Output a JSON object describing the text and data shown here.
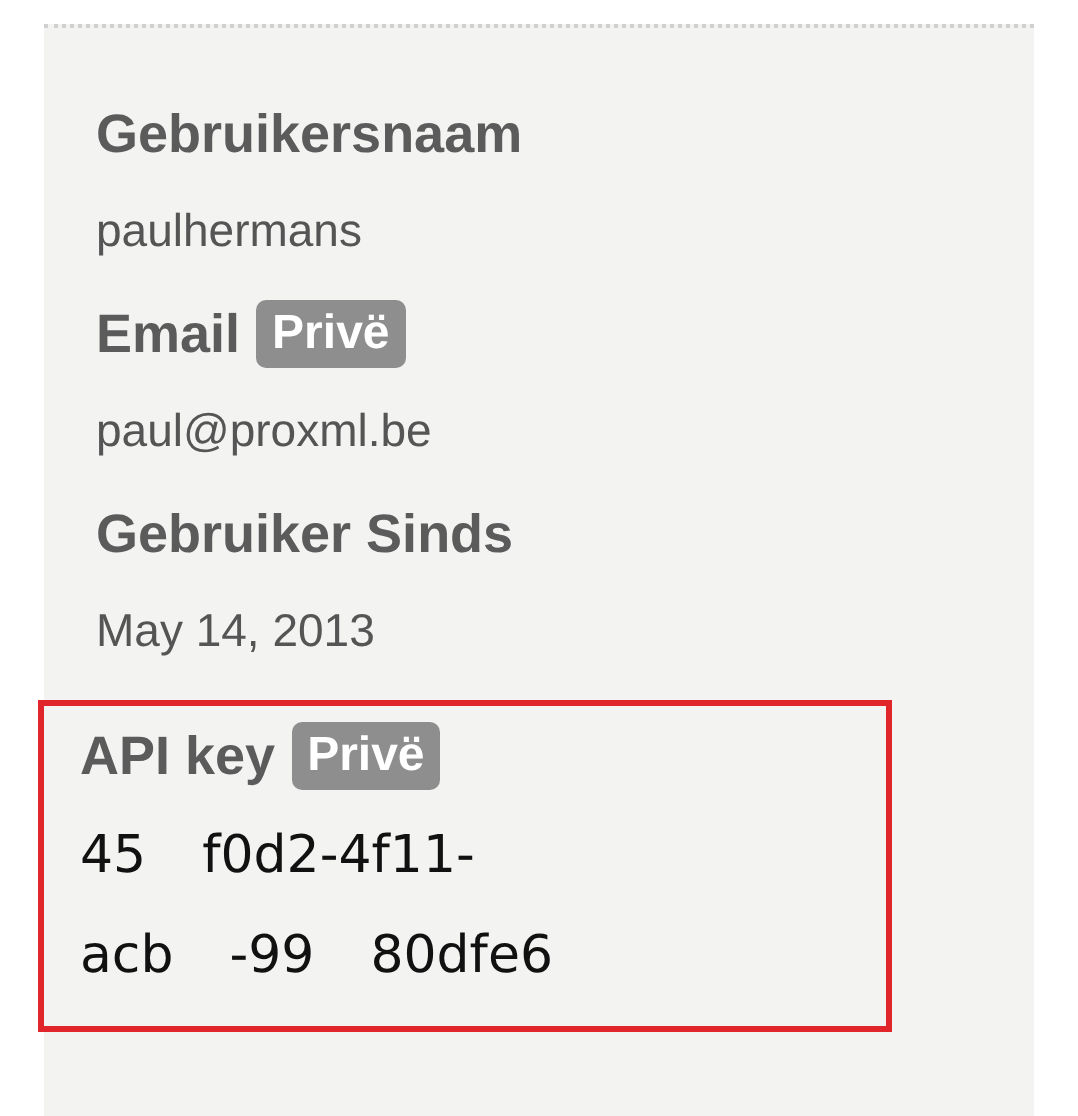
{
  "fields": [
    {
      "label": "Gebruikersnaam",
      "value": "paulhermans"
    },
    {
      "label": "Email",
      "badge": "Privë",
      "value": "paul@proxml.be"
    },
    {
      "label": "Gebruiker Sinds",
      "value": "May 14, 2013"
    }
  ],
  "api_key": {
    "label": "API key",
    "badge": "Privë",
    "lines": [
      [
        "45",
        "f0d2-4f11-"
      ],
      [
        "acb",
        "-99",
        "80dfe6"
      ]
    ]
  }
}
